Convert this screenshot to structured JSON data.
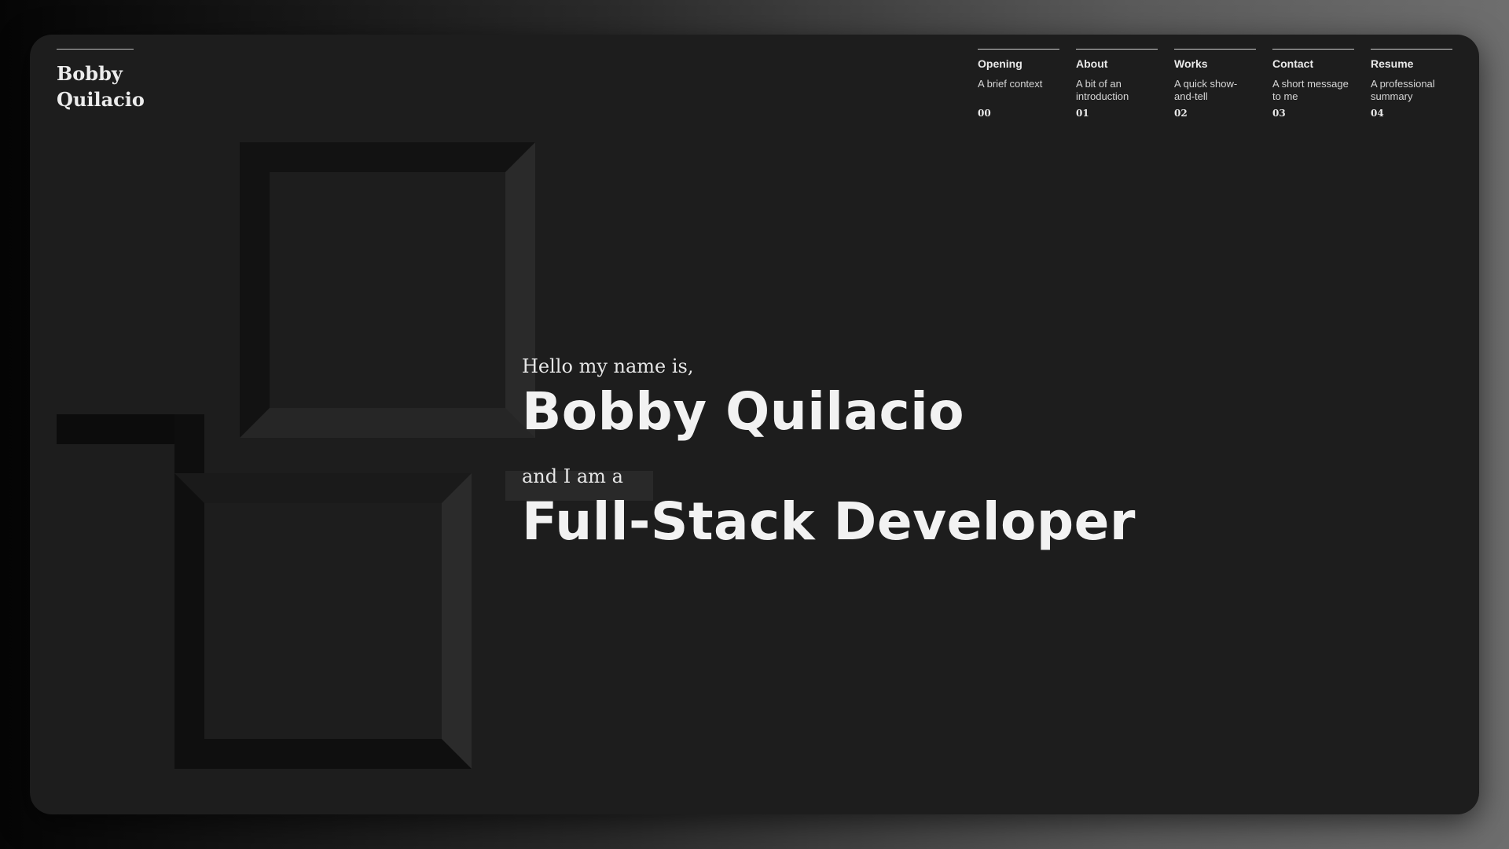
{
  "brand": {
    "line1": "Bobby",
    "line2": "Quilacio"
  },
  "nav": [
    {
      "title": "Opening",
      "desc": "A brief context",
      "num": "00"
    },
    {
      "title": "About",
      "desc": "A bit of an introduction",
      "num": "01"
    },
    {
      "title": "Works",
      "desc": "A quick show-and-tell",
      "num": "02"
    },
    {
      "title": "Contact",
      "desc": "A short message to me",
      "num": "03"
    },
    {
      "title": "Resume",
      "desc": "A professional summary",
      "num": "04"
    }
  ],
  "hero": {
    "greeting": "Hello my name is,",
    "name": "Bobby Quilacio",
    "intro": "and I am a",
    "role": "Full-Stack Developer"
  },
  "colors": {
    "panel": "#1d1d1d",
    "text": "#f2f2f2"
  }
}
